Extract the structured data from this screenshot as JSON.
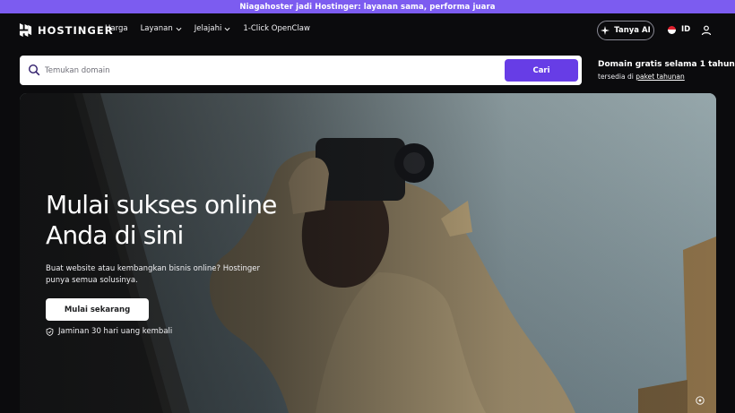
{
  "promo": {
    "text": "Niagahoster jadi Hostinger: layanan sama, performa juara"
  },
  "brand": {
    "name": "HOSTINGER"
  },
  "nav": {
    "items": [
      {
        "label": "Harga",
        "dropdown": false
      },
      {
        "label": "Layanan",
        "dropdown": true
      },
      {
        "label": "Jelajahi",
        "dropdown": true
      },
      {
        "label": "1-Click OpenClaw",
        "dropdown": false
      }
    ],
    "ai_button": "Tanya AI",
    "language": "ID"
  },
  "search": {
    "placeholder": "Temukan domain",
    "value": "",
    "button": "Cari"
  },
  "domain_offer": {
    "title": "Domain gratis selama 1 tahun",
    "sub_prefix": "tersedia di",
    "sub_link": "paket tahunan"
  },
  "hero": {
    "title_line1": "Mulai sukses online",
    "title_line2": "Anda di sini",
    "description": "Buat website atau kembangkan bisnis online? Hostinger punya semua solusinya.",
    "cta": "Mulai sekarang",
    "guarantee": "Jaminan 30 hari uang kembali"
  },
  "colors": {
    "promo_bg": "#7c5cf0",
    "accent": "#673de6",
    "page_bg": "#0b0b0d"
  },
  "icons": [
    "hostinger-logo-icon",
    "chevron-down-icon",
    "sparkle-icon",
    "flag-id-icon",
    "user-icon",
    "search-icon",
    "shield-check-icon",
    "info-icon"
  ]
}
